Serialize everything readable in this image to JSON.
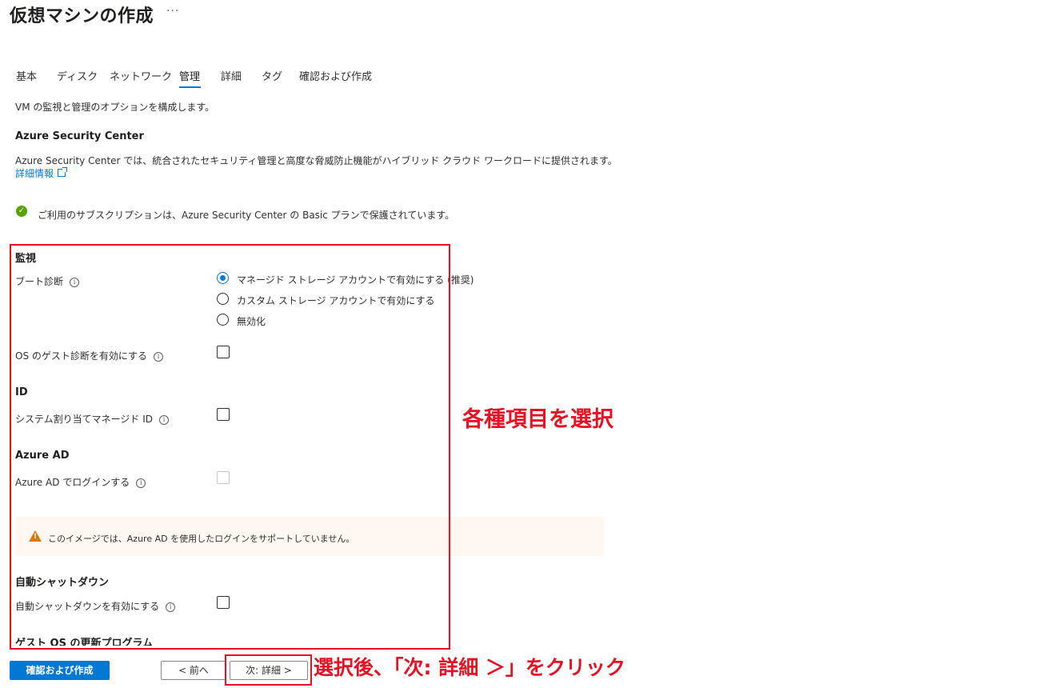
{
  "header": {
    "title": "仮想マシンの作成",
    "more": "···"
  },
  "tabs": [
    {
      "label": "基本",
      "active": false
    },
    {
      "label": "ディスク",
      "active": false
    },
    {
      "label": "ネットワーク",
      "active": false
    },
    {
      "label": "管理",
      "active": true
    },
    {
      "label": "詳細",
      "active": false
    },
    {
      "label": "タグ",
      "active": false
    },
    {
      "label": "確認および作成",
      "active": false
    }
  ],
  "intro": "VM の監視と管理のオプションを構成します。",
  "security": {
    "heading": "Azure Security Center",
    "description": "Azure Security Center では、統合されたセキュリティ管理と高度な脅威防止機能がハイブリッド クラウド ワークロードに提供されます。",
    "link": "詳細情報",
    "status": "ご利用のサブスクリプションは、Azure Security Center の Basic プランで保護されています。"
  },
  "monitoring": {
    "heading": "監視",
    "boot_label": "ブート診断",
    "boot_options": [
      "マネージド ストレージ アカウントで有効にする (推奨)",
      "カスタム ストレージ アカウントで有効にする",
      "無効化"
    ],
    "guest_label": "OS のゲスト診断を有効にする"
  },
  "identity": {
    "heading": "ID",
    "label": "システム割り当てマネージド ID"
  },
  "azure_ad": {
    "heading": "Azure AD",
    "label": "Azure AD でログインする",
    "warning": "このイメージでは、Azure AD を使用したログインをサポートしていません。"
  },
  "shutdown": {
    "heading": "自動シャットダウン",
    "label": "自動シャットダウンを有効にする"
  },
  "guest_update": {
    "heading": "ゲスト OS の更新プログラム"
  },
  "footer": {
    "review_create": "確認および作成",
    "prev": "< 前へ",
    "next": "次: 詳細 >"
  },
  "annotations": {
    "select_items": "各種項目を選択",
    "click_next": "選択後、「次: 詳細 ＞」をクリック"
  },
  "colors": {
    "accent": "#0078d4",
    "annotation": "#e81123",
    "success": "#57a300",
    "warning": "#d87a07"
  }
}
